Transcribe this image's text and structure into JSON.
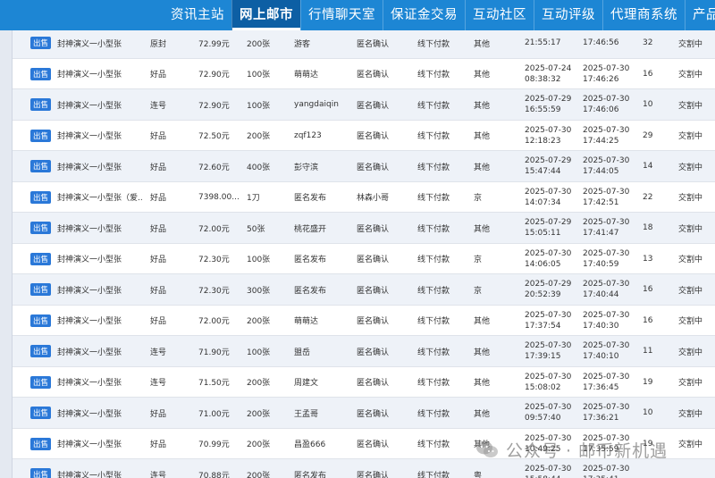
{
  "nav": {
    "items": [
      "资讯主站",
      "网上邮市",
      "行情聊天室",
      "保证金交易",
      "互动社区",
      "互动评级",
      "代理商系统",
      "产品目"
    ],
    "active_index": 1
  },
  "listings": {
    "rows": [
      {
        "action": "出售",
        "name": "封神演义一小型张",
        "grade": "原封",
        "price": "72.99元",
        "qty": "200张",
        "seller": "游客",
        "confirm": "匿名确认",
        "payment": "线下付款",
        "note": "其他",
        "start_date": "",
        "start_time": "21:55:17",
        "update_date": "",
        "update_time": "17:46:56",
        "count": "32",
        "status": "交割中"
      },
      {
        "action": "出售",
        "name": "封神演义一小型张",
        "grade": "好品",
        "price": "72.90元",
        "qty": "100张",
        "seller": "萌萌达",
        "confirm": "匿名确认",
        "payment": "线下付款",
        "note": "其他",
        "start_date": "2025-07-24",
        "start_time": "08:38:32",
        "update_date": "2025-07-30",
        "update_time": "17:46:26",
        "count": "16",
        "status": "交割中"
      },
      {
        "action": "出售",
        "name": "封神演义一小型张",
        "grade": "连号",
        "price": "72.90元",
        "qty": "100张",
        "seller": "yangdaiqin",
        "confirm": "匿名确认",
        "payment": "线下付款",
        "note": "其他",
        "start_date": "2025-07-29",
        "start_time": "16:55:59",
        "update_date": "2025-07-30",
        "update_time": "17:46:06",
        "count": "10",
        "status": "交割中"
      },
      {
        "action": "出售",
        "name": "封神演义一小型张",
        "grade": "好品",
        "price": "72.50元",
        "qty": "200张",
        "seller": "zqf123",
        "confirm": "匿名确认",
        "payment": "线下付款",
        "note": "其他",
        "start_date": "2025-07-30",
        "start_time": "12:18:23",
        "update_date": "2025-07-30",
        "update_time": "17:44:25",
        "count": "29",
        "status": "交割中"
      },
      {
        "action": "出售",
        "name": "封神演义一小型张",
        "grade": "好品",
        "price": "72.60元",
        "qty": "400张",
        "seller": "彭守滨",
        "confirm": "匿名确认",
        "payment": "线下付款",
        "note": "其他",
        "start_date": "2025-07-29",
        "start_time": "15:47:44",
        "update_date": "2025-07-30",
        "update_time": "17:44:05",
        "count": "14",
        "status": "交割中"
      },
      {
        "action": "出售",
        "name": "封神演义一小型张（爱...",
        "grade": "好品",
        "price": "7398.00...",
        "qty": "1刀",
        "seller": "匿名发布",
        "confirm": "林森小哥",
        "payment": "线下付款",
        "note": "京",
        "start_date": "2025-07-30",
        "start_time": "14:07:34",
        "update_date": "2025-07-30",
        "update_time": "17:42:51",
        "count": "22",
        "status": "交割中"
      },
      {
        "action": "出售",
        "name": "封神演义一小型张",
        "grade": "好品",
        "price": "72.00元",
        "qty": "50张",
        "seller": "桃花盛开",
        "confirm": "匿名确认",
        "payment": "线下付款",
        "note": "其他",
        "start_date": "2025-07-29",
        "start_time": "15:05:11",
        "update_date": "2025-07-30",
        "update_time": "17:41:47",
        "count": "18",
        "status": "交割中"
      },
      {
        "action": "出售",
        "name": "封神演义一小型张",
        "grade": "好品",
        "price": "72.30元",
        "qty": "100张",
        "seller": "匿名发布",
        "confirm": "匿名确认",
        "payment": "线下付款",
        "note": "京",
        "start_date": "2025-07-30",
        "start_time": "14:06:05",
        "update_date": "2025-07-30",
        "update_time": "17:40:59",
        "count": "13",
        "status": "交割中"
      },
      {
        "action": "出售",
        "name": "封神演义一小型张",
        "grade": "好品",
        "price": "72.30元",
        "qty": "300张",
        "seller": "匿名发布",
        "confirm": "匿名确认",
        "payment": "线下付款",
        "note": "京",
        "start_date": "2025-07-29",
        "start_time": "20:52:39",
        "update_date": "2025-07-30",
        "update_time": "17:40:44",
        "count": "16",
        "status": "交割中"
      },
      {
        "action": "出售",
        "name": "封神演义一小型张",
        "grade": "好品",
        "price": "72.00元",
        "qty": "200张",
        "seller": "萌萌达",
        "confirm": "匿名确认",
        "payment": "线下付款",
        "note": "其他",
        "start_date": "2025-07-30",
        "start_time": "17:37:54",
        "update_date": "2025-07-30",
        "update_time": "17:40:30",
        "count": "16",
        "status": "交割中"
      },
      {
        "action": "出售",
        "name": "封神演义一小型张",
        "grade": "连号",
        "price": "71.90元",
        "qty": "100张",
        "seller": "盟岳",
        "confirm": "匿名确认",
        "payment": "线下付款",
        "note": "其他",
        "start_date": "2025-07-30",
        "start_time": "17:39:15",
        "update_date": "2025-07-30",
        "update_time": "17:40:10",
        "count": "11",
        "status": "交割中"
      },
      {
        "action": "出售",
        "name": "封神演义一小型张",
        "grade": "连号",
        "price": "71.50元",
        "qty": "200张",
        "seller": "周建文",
        "confirm": "匿名确认",
        "payment": "线下付款",
        "note": "其他",
        "start_date": "2025-07-30",
        "start_time": "15:08:02",
        "update_date": "2025-07-30",
        "update_time": "17:36:45",
        "count": "19",
        "status": "交割中"
      },
      {
        "action": "出售",
        "name": "封神演义一小型张",
        "grade": "好品",
        "price": "71.00元",
        "qty": "200张",
        "seller": "王孟哥",
        "confirm": "匿名确认",
        "payment": "线下付款",
        "note": "其他",
        "start_date": "2025-07-30",
        "start_time": "09:57:40",
        "update_date": "2025-07-30",
        "update_time": "17:36:21",
        "count": "10",
        "status": "交割中"
      },
      {
        "action": "出售",
        "name": "封神演义一小型张",
        "grade": "好品",
        "price": "70.99元",
        "qty": "200张",
        "seller": "昌盈666",
        "confirm": "匿名确认",
        "payment": "线下付款",
        "note": "其他",
        "start_date": "2025-07-30",
        "start_time": "10:49:25",
        "update_date": "2025-07-30",
        "update_time": "17:35:59",
        "count": "19",
        "status": "交割中"
      },
      {
        "action": "出售",
        "name": "封神演义一小型张",
        "grade": "连号",
        "price": "70.88元",
        "qty": "200张",
        "seller": "匿名发布",
        "confirm": "匿名确认",
        "payment": "线下付款",
        "note": "粤",
        "start_date": "2025-07-30",
        "start_time": "15:58:44",
        "update_date": "2025-07-30",
        "update_time": "17:35:41",
        "count": "",
        "status": ""
      }
    ]
  },
  "watermark": {
    "text": "公众号 · 邮币新机遇"
  },
  "colors": {
    "nav_bg": "#1d86d4",
    "nav_active": "#0d5fa4",
    "button_bg": "#2a78d8",
    "row_alt": "#eef2f8"
  }
}
